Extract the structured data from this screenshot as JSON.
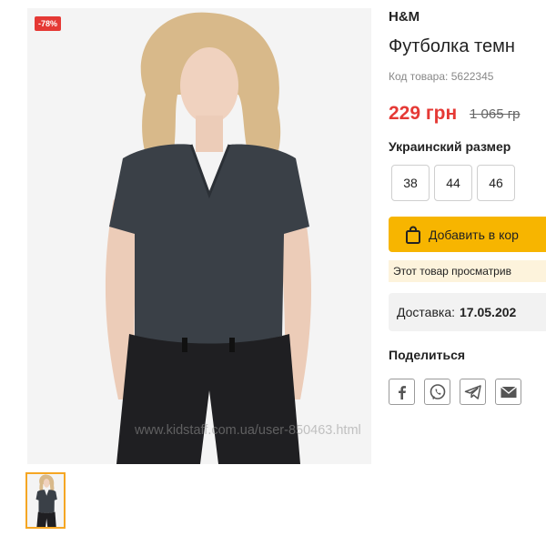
{
  "product": {
    "discount_badge": "-78%",
    "watermark": "www.kidstaff.com.ua/user-850463.html",
    "brand": "H&M",
    "title": "Футболка темн",
    "sku_label": "Код товара:",
    "sku_value": "5622345",
    "price": "229 грн",
    "old_price": "1 065 гр",
    "size_label": "Украинский размер",
    "sizes": [
      "38",
      "44",
      "46"
    ],
    "add_to_cart": "Добавить в кор",
    "viewed_notice": "Этот товар просматрив",
    "delivery_label": "Доставка:",
    "delivery_date": "17.05.202",
    "share_label": "Поделиться"
  },
  "colors": {
    "accent": "#f7b500",
    "price": "#e53935",
    "badge": "#e53935",
    "thumb_border": "#f5a623"
  },
  "icons": [
    "facebook-icon",
    "viber-icon",
    "telegram-icon",
    "email-icon",
    "shopping-bag-icon"
  ]
}
